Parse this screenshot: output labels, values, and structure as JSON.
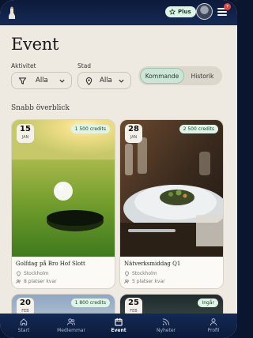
{
  "header": {
    "plus_label": "Plus",
    "notification_count": "7"
  },
  "page": {
    "title": "Event"
  },
  "filters": {
    "activity": {
      "label": "Aktivitet",
      "value": "Alla"
    },
    "city": {
      "label": "Stad",
      "value": "Alla"
    },
    "segment": {
      "upcoming": "Kommande",
      "history": "Historik"
    }
  },
  "section": {
    "title": "Snabb överblick"
  },
  "events": [
    {
      "day": "15",
      "month": "JAN",
      "credits": "1 500 credits",
      "title": "Golfdag på Bro Hof Slott",
      "location": "Stockholm",
      "spots": "8 platser kvar"
    },
    {
      "day": "28",
      "month": "JAN",
      "credits": "2 500 credits",
      "title": "Nätverksmiddag Q1",
      "location": "Stockholm",
      "spots": "5 platser kvar"
    },
    {
      "day": "20",
      "month": "FEB",
      "credits": "1 800 credits"
    },
    {
      "day": "25",
      "month": "FEB",
      "credits": "Ingår"
    }
  ],
  "nav": [
    {
      "label": "Start",
      "icon": "home-icon"
    },
    {
      "label": "Medlemmar",
      "icon": "users-icon"
    },
    {
      "label": "Event",
      "icon": "calendar-icon"
    },
    {
      "label": "Nyheter",
      "icon": "rss-icon"
    },
    {
      "label": "Profil",
      "icon": "user-icon"
    }
  ],
  "colors": {
    "navy": "#0c1a3a",
    "background": "#eeeae2",
    "accent_green": "#cde5d6",
    "badge_red": "#e2453f"
  }
}
